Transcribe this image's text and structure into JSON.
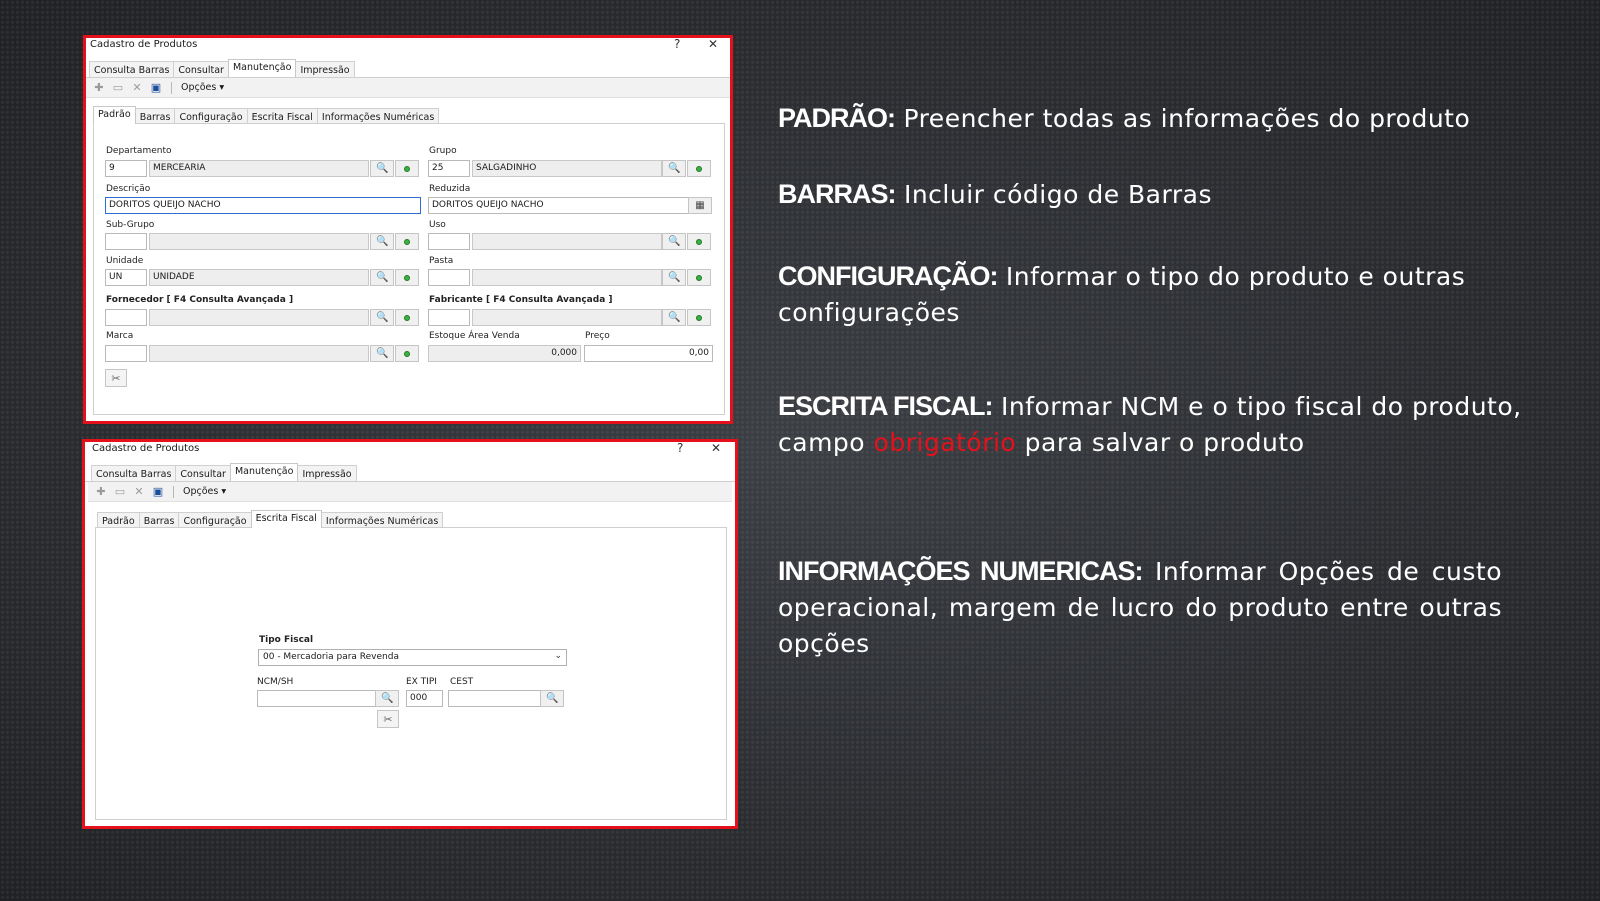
{
  "colors": {
    "accent_red": "#e4111c",
    "text_white": "#ffffff"
  },
  "window1": {
    "title": "Cadastro de Produtos",
    "help": "?",
    "close": "✕",
    "top_tabs": [
      "Consulta Barras",
      "Consultar",
      "Manutenção",
      "Impressão"
    ],
    "toolbar": {
      "opcoes": "Opções ▾"
    },
    "sub_tabs": [
      "Padrão",
      "Barras",
      "Configuração",
      "Escrita Fiscal",
      "Informações Numéricas"
    ],
    "fields": {
      "departamento_label": "Departamento",
      "departamento_code": "9",
      "departamento_name": "MERCEARIA",
      "grupo_label": "Grupo",
      "grupo_code": "25",
      "grupo_name": "SALGADINHO",
      "descricao_label": "Descrição",
      "descricao_value": "DORITOS QUEIJO NACHO",
      "reduzida_label": "Reduzida",
      "reduzida_value": "DORITOS QUEIJO NACHO",
      "subgrupo_label": "Sub-Grupo",
      "uso_label": "Uso",
      "unidade_label": "Unidade",
      "unidade_code": "UN",
      "unidade_name": "UNIDADE",
      "pasta_label": "Pasta",
      "fornecedor_label": "Fornecedor [ F4 Consulta Avançada ]",
      "fabricante_label": "Fabricante [ F4 Consulta Avançada ]",
      "marca_label": "Marca",
      "estoque_label": "Estoque Área Venda",
      "estoque_value": "0,000",
      "preco_label": "Preço",
      "preco_value": "0,00"
    }
  },
  "window2": {
    "title": "Cadastro de Produtos",
    "help": "?",
    "close": "✕",
    "top_tabs": [
      "Consulta Barras",
      "Consultar",
      "Manutenção",
      "Impressão"
    ],
    "toolbar": {
      "opcoes": "Opções ▾"
    },
    "sub_tabs": [
      "Padrão",
      "Barras",
      "Configuração",
      "Escrita Fiscal",
      "Informações Numéricas"
    ],
    "fields": {
      "tipo_fiscal_label": "Tipo Fiscal",
      "tipo_fiscal_value": "00 - Mercadoria para Revenda",
      "ncm_label": "NCM/SH",
      "ncm_value": "",
      "extipi_label": "EX TIPI",
      "extipi_value": "000",
      "cest_label": "CEST",
      "cest_value": ""
    }
  },
  "descriptions": {
    "padrao_key": "PADRÃO:",
    "padrao_text": " Preencher todas as informações do produto",
    "barras_key": "BARRAS:",
    "barras_text": " Incluir código de Barras",
    "config_key": "CONFIGURAÇÃO:",
    "config_text": " Informar o tipo do produto e outras configurações",
    "fiscal_key": "ESCRITA FISCAL:",
    "fiscal_text1": " Informar NCM e o tipo fiscal do produto,",
    "fiscal_text2a": "campo ",
    "fiscal_red": "obrigatório",
    "fiscal_text2b": " para salvar o produto",
    "numericas_key": "INFORMAÇÕES NUMERICAS:",
    "numericas_text": " Informar Opções de custo operacional, margem de lucro do produto entre outras opções"
  }
}
